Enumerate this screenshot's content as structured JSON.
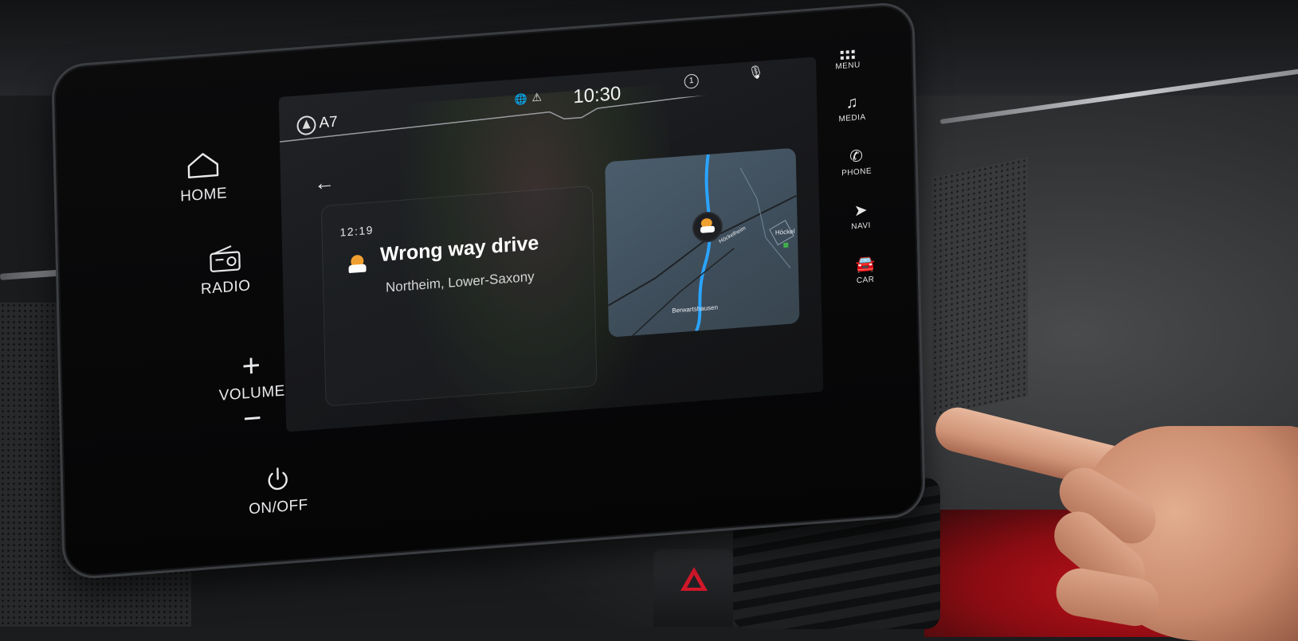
{
  "hardkeys": {
    "home": "HOME",
    "radio": "RADIO",
    "volume": "VOLUME",
    "volume_up": "+",
    "volume_down": "−",
    "onoff": "ON/OFF"
  },
  "statusbar": {
    "road": "A7",
    "clock": "10:30",
    "notification_count": "1"
  },
  "alert": {
    "time": "12:19",
    "title": "Wrong way drive",
    "location": "Northeim, Lower-Saxony"
  },
  "map": {
    "labels": [
      "Berwartshausen",
      "Höckel",
      "Höckelheim"
    ],
    "icon": "wrong-way-driver-icon"
  },
  "side_menu": {
    "items": [
      {
        "label": "MENU",
        "icon": "grid-icon"
      },
      {
        "label": "MEDIA",
        "icon": "music-note-icon"
      },
      {
        "label": "PHONE",
        "icon": "phone-icon"
      },
      {
        "label": "NAVI",
        "icon": "navigation-arrow-icon"
      },
      {
        "label": "CAR",
        "icon": "car-icon"
      }
    ]
  },
  "colors": {
    "warning": "#f0a030",
    "route": "#2aa4ff",
    "hazard": "#d0182a"
  }
}
